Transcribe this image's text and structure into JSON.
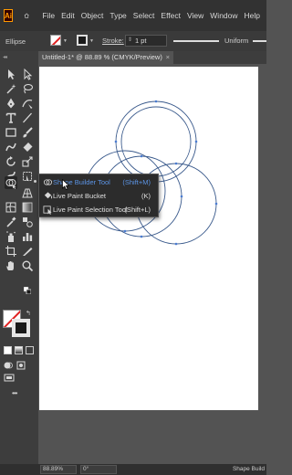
{
  "menubar": {
    "logo": "Ai",
    "items": [
      "File",
      "Edit",
      "Object",
      "Type",
      "Select",
      "Effect",
      "View",
      "Window",
      "Help"
    ]
  },
  "control_bar": {
    "selection_label": "Ellipse",
    "stroke_label": "Stroke:",
    "stroke_weight": "1 pt",
    "stroke_profile": "Uniform",
    "fill_color": "#ffffff",
    "stroke_color": "#1a1a1a"
  },
  "document_tab": {
    "title": "Untitled-1* @ 88.89 % (CMYK/Preview)",
    "close": "×"
  },
  "flyout": {
    "items": [
      {
        "label": "Shape Builder Tool",
        "shortcut": "(Shift+M)",
        "active": true
      },
      {
        "label": "Live Paint Bucket",
        "shortcut": "(K)",
        "active": false
      },
      {
        "label": "Live Paint Selection Tool",
        "shortcut": "(Shift+L)",
        "active": false
      }
    ]
  },
  "toolbar": {
    "icons": [
      "selection-tool",
      "direct-selection-tool",
      "magic-wand-tool",
      "lasso-tool",
      "pen-tool",
      "curvature-tool",
      "type-tool",
      "line-segment-tool",
      "rectangle-tool",
      "paintbrush-tool",
      "shaper-tool",
      "eraser-tool",
      "rotate-tool",
      "scale-tool",
      "warp-tool",
      "free-transform-tool",
      "shape-builder-tool",
      "perspective-grid-tool",
      "mesh-tool",
      "gradient-tool",
      "eyedropper-tool",
      "blend-tool",
      "symbol-sprayer-tool",
      "column-graph-tool",
      "artboard-tool",
      "slice-tool",
      "hand-tool",
      "zoom-tool"
    ],
    "more": "•••"
  },
  "artwork": {
    "stroke_color": "#3a5a8c",
    "anchor_color": "#4a7bd0"
  },
  "status_bar": {
    "zoom": "88.89%",
    "rotation": "0°",
    "current_tool": "Shape Build"
  }
}
